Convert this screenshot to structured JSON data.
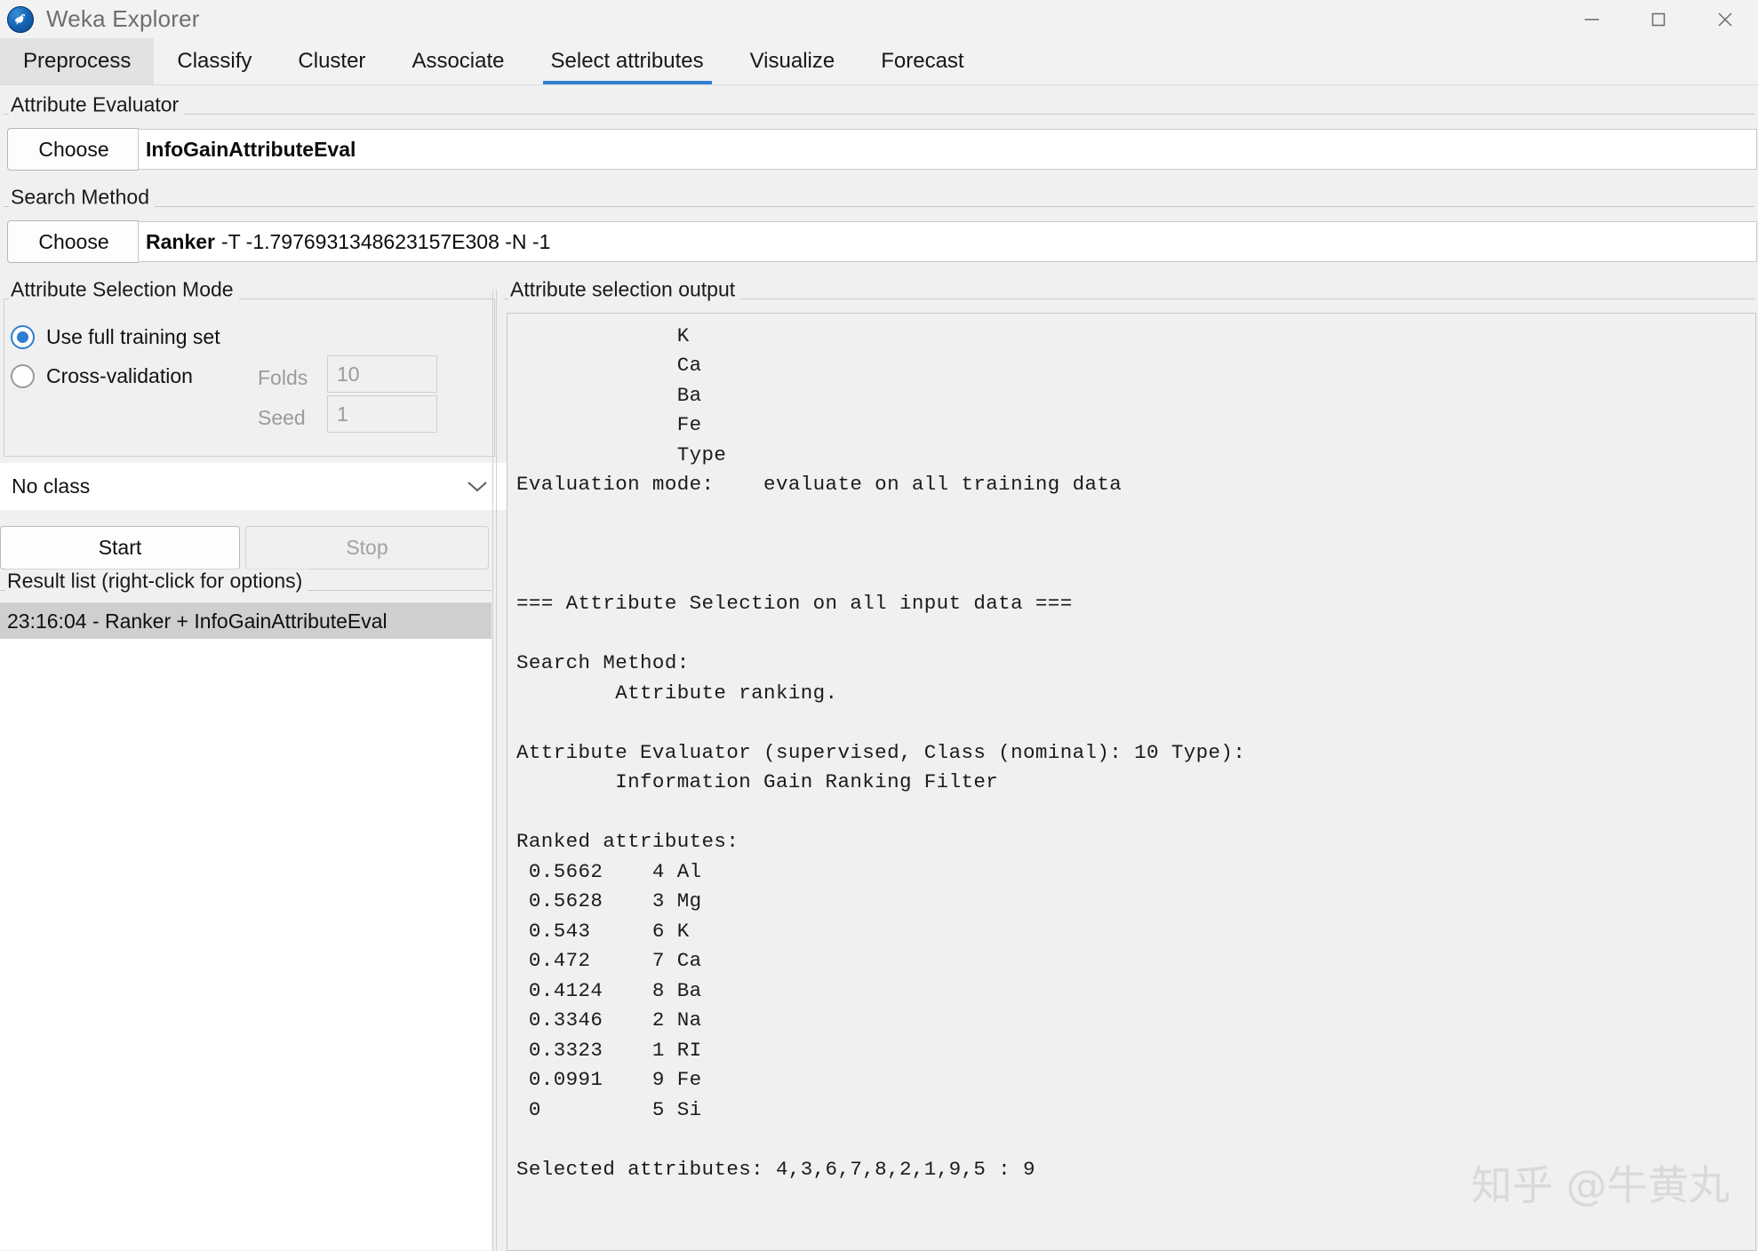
{
  "window": {
    "title": "Weka Explorer",
    "icon": "weka-bird-icon",
    "controls": {
      "minimize": "minimize-icon",
      "maximize": "maximize-icon",
      "close": "close-icon"
    }
  },
  "tabs": [
    {
      "label": "Preprocess",
      "state": "hovered"
    },
    {
      "label": "Classify",
      "state": "normal"
    },
    {
      "label": "Cluster",
      "state": "normal"
    },
    {
      "label": "Associate",
      "state": "normal"
    },
    {
      "label": "Select attributes",
      "state": "active"
    },
    {
      "label": "Visualize",
      "state": "normal"
    },
    {
      "label": "Forecast",
      "state": "normal"
    }
  ],
  "attribute_evaluator": {
    "group_title": "Attribute Evaluator",
    "choose_label": "Choose",
    "value_name": "InfoGainAttributeEval",
    "value_options": ""
  },
  "search_method": {
    "group_title": "Search Method",
    "choose_label": "Choose",
    "value_name": "Ranker",
    "value_options": "-T -1.7976931348623157E308 -N -1"
  },
  "selection_mode": {
    "group_title": "Attribute Selection Mode",
    "full_training_label": "Use full training set",
    "cross_validation_label": "Cross-validation",
    "selected": "Use full training set",
    "folds_label": "Folds",
    "folds_value": "10",
    "seed_label": "Seed",
    "seed_value": "1"
  },
  "class_combo": {
    "value": "No class",
    "chevron": "chevron-down-icon"
  },
  "actions": {
    "start_label": "Start",
    "stop_label": "Stop",
    "stop_enabled": false
  },
  "result_list": {
    "group_title": "Result list (right-click for options)",
    "items": [
      {
        "label": "23:16:04 - Ranker + InfoGainAttributeEval",
        "selected": true
      }
    ]
  },
  "output": {
    "group_title": "Attribute selection output",
    "text": "             K\n             Ca\n             Ba\n             Fe\n             Type\nEvaluation mode:    evaluate on all training data\n\n\n\n=== Attribute Selection on all input data ===\n\nSearch Method:\n        Attribute ranking.\n\nAttribute Evaluator (supervised, Class (nominal): 10 Type):\n        Information Gain Ranking Filter\n\nRanked attributes:\n 0.5662    4 Al\n 0.5628    3 Mg\n 0.543     6 K\n 0.472     7 Ca\n 0.4124    8 Ba\n 0.3346    2 Na\n 0.3323    1 RI\n 0.0991    9 Fe\n 0         5 Si\n\nSelected attributes: 4,3,6,7,8,2,1,9,5 : 9\n"
  },
  "ranked_attributes": [
    {
      "merit": "0.5662",
      "index": "4",
      "name": "Al"
    },
    {
      "merit": "0.5628",
      "index": "3",
      "name": "Mg"
    },
    {
      "merit": "0.543",
      "index": "6",
      "name": "K"
    },
    {
      "merit": "0.472",
      "index": "7",
      "name": "Ca"
    },
    {
      "merit": "0.4124",
      "index": "8",
      "name": "Ba"
    },
    {
      "merit": "0.3346",
      "index": "2",
      "name": "Na"
    },
    {
      "merit": "0.3323",
      "index": "1",
      "name": "RI"
    },
    {
      "merit": "0.0991",
      "index": "9",
      "name": "Fe"
    },
    {
      "merit": "0",
      "index": "5",
      "name": "Si"
    }
  ],
  "watermark": {
    "text": "知乎 @牛黄丸"
  },
  "colors": {
    "accent": "#2f7fd1",
    "window_bg": "#f0f0f0",
    "titlebar_bg": "#f2f2f2",
    "selection_bg": "#cfcfcf"
  }
}
